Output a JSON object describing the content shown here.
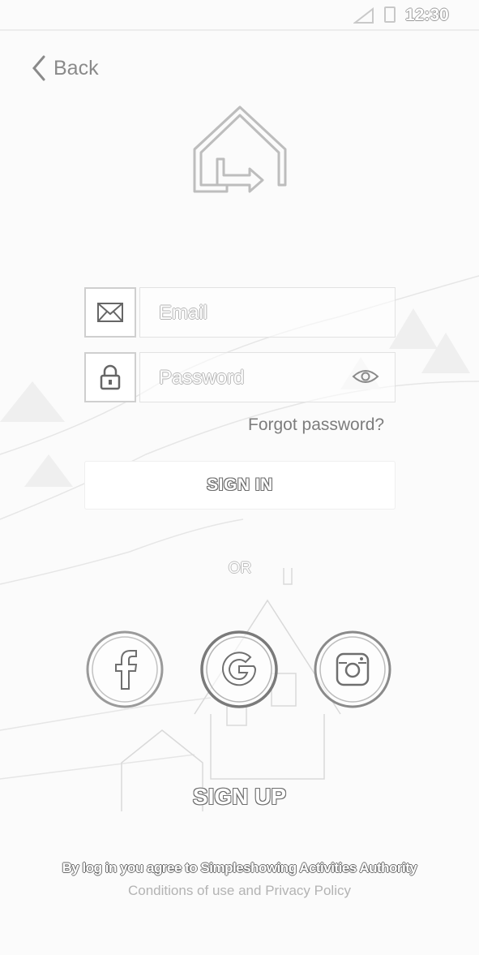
{
  "status_bar": {
    "time": "12:30"
  },
  "nav": {
    "back_label": "Back"
  },
  "form": {
    "email_placeholder": "Email",
    "email_value": "",
    "password_placeholder": "Password",
    "password_value": "",
    "forgot_label": "Forgot password?",
    "signin_label": "SIGN IN"
  },
  "divider": {
    "or_label": "OR"
  },
  "social": [
    {
      "name": "facebook",
      "icon": "facebook-icon"
    },
    {
      "name": "google",
      "icon": "google-icon"
    },
    {
      "name": "instagram",
      "icon": "instagram-icon"
    }
  ],
  "signup_label": "SIGN UP",
  "terms": {
    "line1": "By log in you agree to Simpleshowing Activities Authority",
    "conditions_label": "Conditions of use",
    "and_label": " and ",
    "privacy_label": "Privacy Policy"
  }
}
